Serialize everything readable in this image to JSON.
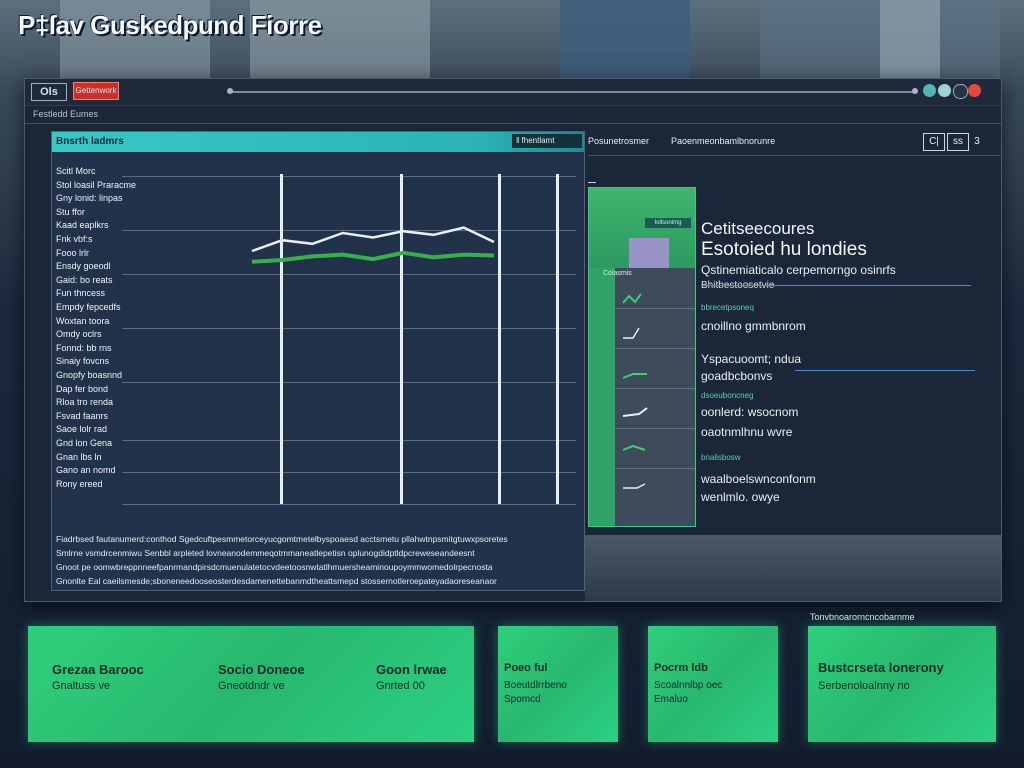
{
  "page": {
    "title": "P‡ſav Guskedpund Fiorre"
  },
  "window": {
    "logo": "Ols",
    "tag": "Gettenwork",
    "menu_label": "Festledd Eumes"
  },
  "chart_panel": {
    "title": "Bnsrth ladmrs",
    "head_right": "‖ fhentlamt",
    "row_labels": [
      "Scitl Morc",
      "Stol loasil Praracme",
      "Gny lonid: linpas",
      "Stu ffor",
      "Kaad eaplkrs",
      "Fnk vbf:s",
      "Fooo lrlr",
      "Ensdy goeodl",
      "Gaid: bo reats",
      "Fun thncess",
      "Empdy fepcedfs",
      "Woxtan toora",
      "Omdy oclrs",
      "Fonnd: bb rns",
      "Sinaiy fovcns",
      "Gnopfy boasnnd",
      "Dap fer bond",
      "Rloa tro renda",
      "Fsvad faanrs",
      "Saoe lolr rad",
      "Gnd lon Gena",
      "Gnan lbs ln",
      "Gano an nomd",
      "Rony ereed"
    ],
    "footnote_lines": [
      "Fiadrbsed fautanumerd:conthod Sgedcuftpesmmetorceyucgomtmetelbyspoaesd acctsmetu pllahwtnpsmitgtuwxpsoretes",
      "Smlrne vsmdrcenmiwu Senbbl arpleted lovneanodemmeqotmmaneatlepetisn oplunogdidptldpcreweseandeesnt",
      "Gnoot pe oomwbreppnneefpanrmandpirsdcmuenulatetocvdeetoosnwtatlhmuersheaminoupoymmwomedolrpecnosta",
      "Gnonlte Eal caeilsmesde;sboneneedooseosterdesdamenettebanmdtheattsmepd stossernotleroepateyadaoreseanaor"
    ]
  },
  "top_tabs": {
    "tab1": "Posunetrosmer",
    "tab2": "Paoenmeonbamlbnorunre",
    "controls": [
      "C|",
      "ss",
      "3"
    ]
  },
  "thumbs": {
    "top_label": "Iollsonimg",
    "col_label": "Colasmis"
  },
  "info_panel": {
    "title": "Cetitseecoures",
    "subtitle": "Esotoied hu londies",
    "line1": "Qstinemiaticalo cerpemorngo osinrfs",
    "small1": "Bhitbestoosetvie",
    "tiny1": "bbrecetpsoneq",
    "line2": "cnoillno gmmbnrom",
    "line3": "Yspacuoomt; ndua",
    "line4": "goadbcbonvs",
    "tiny2": "dsoeuboncneg",
    "line5": "oonlerd: wsocnom",
    "line6": "oaotnmlhnu wvre",
    "tiny3": "bnalisbosw",
    "line7": "waalboelswnconfonm",
    "line8": "wenlmlo. owye"
  },
  "tiles": {
    "caption": "Tonvbnoarorncncobarnme",
    "t1_a": "Grezaa Barooc",
    "t1_b": "Gnaltuss ve",
    "t1_c": "Socio Doneoe",
    "t1_d": "Gneotdndr ve",
    "t1_e": "Goon lrwae",
    "t1_f": "Gnrted 00",
    "t2_a": "Poeo ful",
    "t2_b": "Boeutdlrrbeno",
    "t2_c": "Spomcd",
    "t3_a": "Pocrm ldb",
    "t3_b": "Scoalnnlbp oec",
    "t3_c": "Emaluo",
    "t4_a": "Bustcrseta lonerony",
    "t4_b": "Serbenoloalnny no"
  },
  "colors": {
    "accent_cyan": "#37c9c4",
    "accent_green": "#2fd07a",
    "chart_line_white": "#e8eef2",
    "chart_line_green": "#37b04a"
  },
  "chart_data": {
    "type": "line",
    "series": [
      {
        "values": [
          40,
          52,
          48,
          60,
          55,
          62,
          58,
          66,
          50
        ]
      },
      {
        "values": [
          28,
          30,
          34,
          36,
          31,
          38,
          33,
          36,
          35
        ]
      }
    ]
  }
}
